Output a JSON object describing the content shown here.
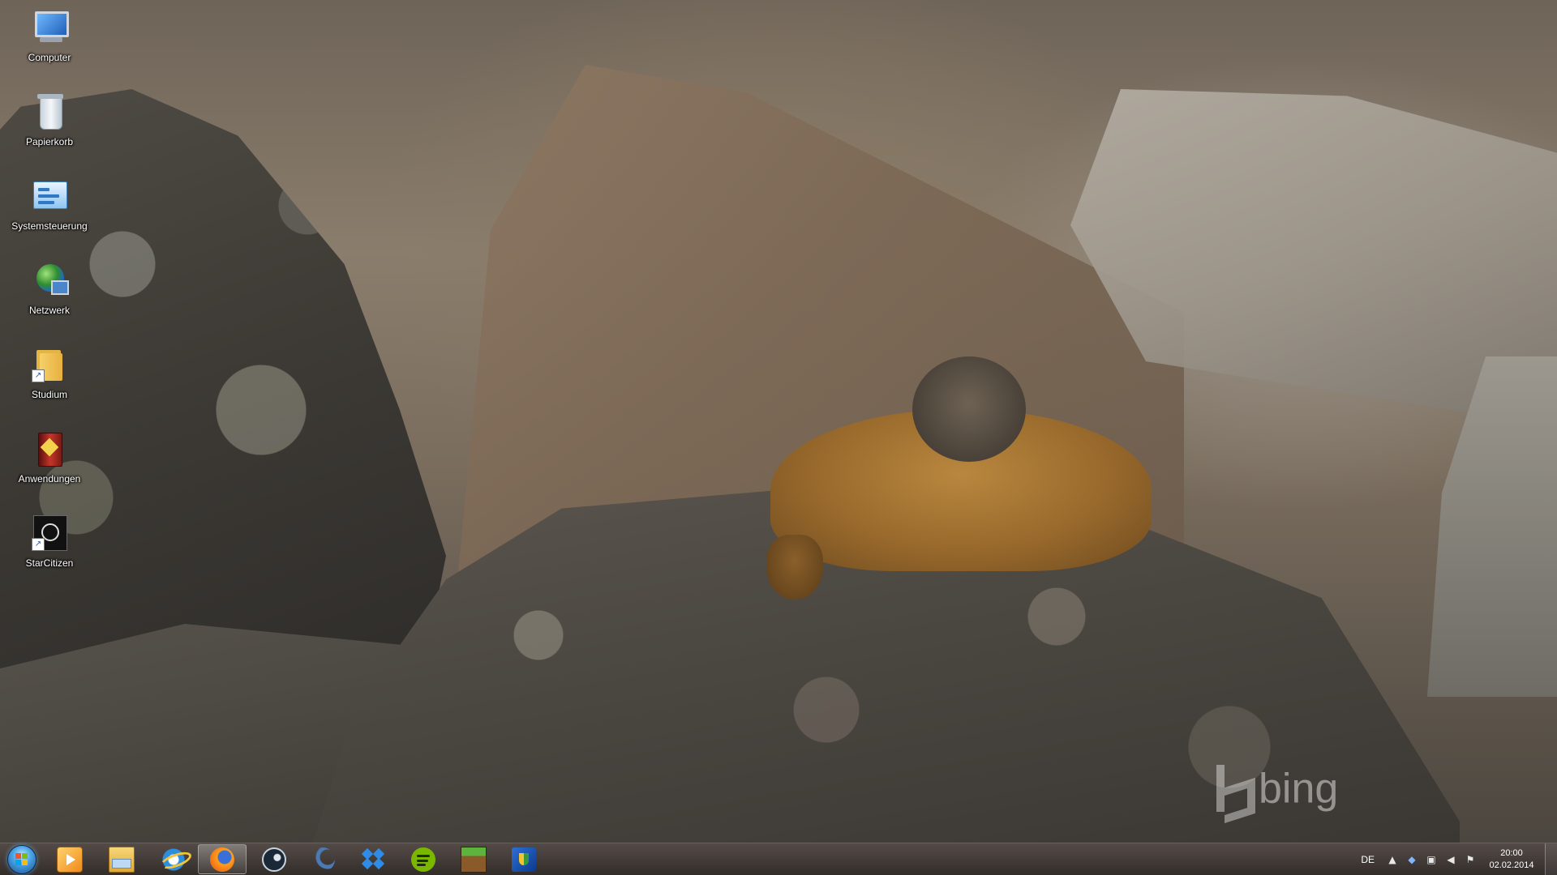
{
  "desktop": {
    "icons": [
      {
        "label": "Computer",
        "icon": "computer-icon"
      },
      {
        "label": "Papierkorb",
        "icon": "recycle-bin-icon"
      },
      {
        "label": "Systemsteuerung",
        "icon": "control-panel-icon"
      },
      {
        "label": "Netzwerk",
        "icon": "network-icon"
      },
      {
        "label": "Studium",
        "icon": "folder-shortcut-icon"
      },
      {
        "label": "Anwendungen",
        "icon": "apps-folder-icon"
      },
      {
        "label": "StarCitizen",
        "icon": "starcitizen-shortcut-icon"
      }
    ],
    "watermark": "bing"
  },
  "taskbar": {
    "pinned": [
      {
        "name": "windows-media-player",
        "icon": "media-player-icon"
      },
      {
        "name": "windows-explorer",
        "icon": "folder-icon"
      },
      {
        "name": "internet-explorer",
        "icon": "internet-explorer-icon"
      },
      {
        "name": "firefox",
        "icon": "firefox-icon",
        "active": true
      },
      {
        "name": "steam",
        "icon": "steam-icon"
      },
      {
        "name": "app-crescent",
        "icon": "crescent-icon"
      },
      {
        "name": "dropbox",
        "icon": "dropbox-icon"
      },
      {
        "name": "spotify",
        "icon": "spotify-icon"
      },
      {
        "name": "minecraft",
        "icon": "minecraft-icon"
      },
      {
        "name": "security-app",
        "icon": "shield-icon"
      }
    ],
    "tray": {
      "language": "DE",
      "icons": [
        "show-hidden-icons-icon",
        "dropbox-tray-icon",
        "network-tray-icon",
        "volume-icon",
        "action-center-flag-icon"
      ],
      "time": "20:00",
      "date": "02.02.2014"
    }
  }
}
